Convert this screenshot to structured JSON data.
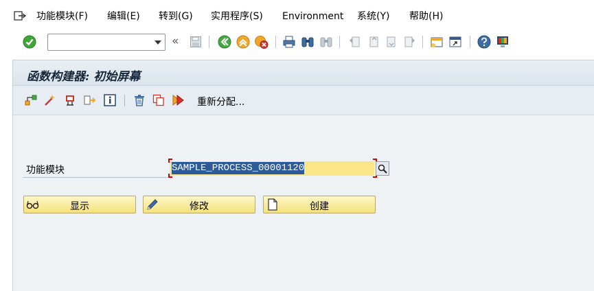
{
  "menubar": {
    "items": [
      {
        "label": "功能模块(F)"
      },
      {
        "label": "编辑(E)"
      },
      {
        "label": "转到(G)"
      },
      {
        "label": "实用程序(S)"
      },
      {
        "label": "Environment"
      },
      {
        "label": "系统(Y)"
      },
      {
        "label": "帮助(H)"
      }
    ]
  },
  "toolbar": {
    "command_field_value": "",
    "history_glyph": "«"
  },
  "screen": {
    "title": "函数构建器: 初始屏幕",
    "app_toolbar": {
      "reassign_label": "重新分配..."
    },
    "form": {
      "function_module_label": "功能模块",
      "function_module_value": "SAMPLE_PROCESS_00001120"
    },
    "buttons": {
      "display": "显示",
      "change": "修改",
      "create": "创建"
    }
  },
  "colors": {
    "input_highlight": "#fbe68a",
    "selection": "#2d5b9a",
    "required_marker": "#d20000",
    "pushbutton": "#f6e27a"
  }
}
